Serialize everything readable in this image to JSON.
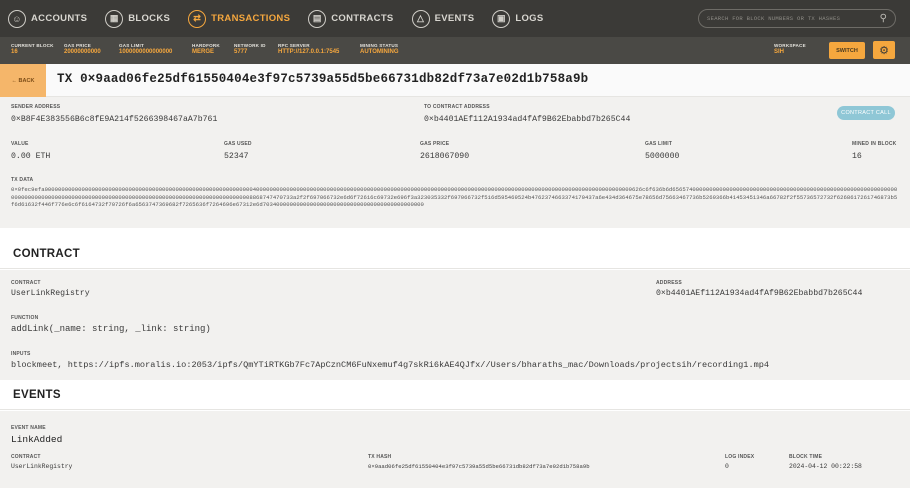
{
  "nav": {
    "items": [
      {
        "label": "ACCOUNTS",
        "icon": "account-icon"
      },
      {
        "label": "BLOCKS",
        "icon": "blocks-icon"
      },
      {
        "label": "TRANSACTIONS",
        "icon": "transactions-icon"
      },
      {
        "label": "CONTRACTS",
        "icon": "contracts-icon"
      },
      {
        "label": "EVENTS",
        "icon": "events-icon"
      },
      {
        "label": "LOGS",
        "icon": "logs-icon"
      }
    ],
    "active": "TRANSACTIONS",
    "search_placeholder": "SEARCH FOR BLOCK NUMBERS OR TX HASHES"
  },
  "status": {
    "current_block": {
      "label": "CURRENT BLOCK",
      "value": "16"
    },
    "gas_price": {
      "label": "GAS PRICE",
      "value": "20000000000"
    },
    "gas_limit": {
      "label": "GAS LIMIT",
      "value": "1000000000000000"
    },
    "hardfork": {
      "label": "HARDFORK",
      "value": "MERGE"
    },
    "network_id": {
      "label": "NETWORK ID",
      "value": "5777"
    },
    "rpc_server": {
      "label": "RPC SERVER",
      "value": "HTTP://127.0.0.1:7545"
    },
    "mining_status": {
      "label": "MINING STATUS",
      "value": "AUTOMINING"
    },
    "workspace": {
      "label": "WORKSPACE",
      "value": "SIH"
    },
    "switch_label": "SWITCH"
  },
  "tx": {
    "back_label": "← BACK",
    "title": "TX 0×9aad06fe25df61550404e3f97c5739a55d5be66731db82df73a7e02d1b758a9b",
    "sender_label": "SENDER ADDRESS",
    "sender": "0×B8F4E383556B6c8fE9A214f5266398467aA7b761",
    "to_label": "TO CONTRACT ADDRESS",
    "to": "0×b4401AEf112A1934ad4fAf9B62Ebabbd7b265C44",
    "call_badge": "CONTRACT CALL",
    "value_label": "VALUE",
    "value": "0.00 ETH",
    "gas_used_label": "GAS USED",
    "gas_used": "52347",
    "gas_price_label": "GAS PRICE",
    "gas_price": "2618067090",
    "gas_limit_label": "GAS LIMIT",
    "gas_limit": "5000000",
    "mined_label": "MINED IN BLOCK",
    "mined": "16",
    "data_label": "TX DATA",
    "data": "0×0fec9efa0000000000000000000000000000000000000000000000000000000000000040000000000000000000000000000000000000000000000000000000000000000000000000000000000000000000000000000000000000009626c6f636b6d6565740000000000000000000000000000000000000000000000000000000000000000000000000000000000000000000000000000000000000000000000000000000000008868747470733a2f2f697066732e6d6f72616c69732e696f3a323035332f697066732f516d595469524b4762374663374170437a6e434d364675e78656d75663467736b5269366b41453451346a66782f2f55736572732f6268617261746873b5f6d61632f446f776e6c6f6164732f70726f6a6563747369682f7265636f7264696e67312e6d703400000000000000000000000000000000000000000000"
  },
  "contract": {
    "section_title": "CONTRACT",
    "contract_label": "CONTRACT",
    "contract_name": "UserLinkRegistry",
    "address_label": "ADDRESS",
    "address": "0×b4401AEf112A1934ad4fAf9B62Ebabbd7b265C44",
    "function_label": "FUNCTION",
    "function": "addLink(_name: string, _link: string)",
    "inputs_label": "INPUTS",
    "inputs": "blockmeet, https://ipfs.moralis.io:2053/ipfs/QmYTiRTKGb7Fc7ApCznCM6FuNxemuf4g7skRi6kAE4QJfx//Users/bharaths_mac/Downloads/projectsih/recording1.mp4"
  },
  "events": {
    "section_title": "EVENTS",
    "event_name_label": "EVENT NAME",
    "event_name": "LinkAdded",
    "contract_label": "CONTRACT",
    "contract": "UserLinkRegistry",
    "tx_hash_label": "TX HASH",
    "tx_hash": "0×9aad06fe25df61550404e3f97c5739a55d5be66731db82df73a7e02d1b758a9b",
    "log_index_label": "LOG INDEX",
    "log_index": "0",
    "block_time_label": "BLOCK TIME",
    "block_time": "2024-04-12 00:22:58"
  },
  "colors": {
    "accent": "#f5a73e",
    "nav_bg": "#3b3a37",
    "status_bg": "#4a4945",
    "panel_bg": "#f2f1ef",
    "badge": "#8fc7d6"
  }
}
